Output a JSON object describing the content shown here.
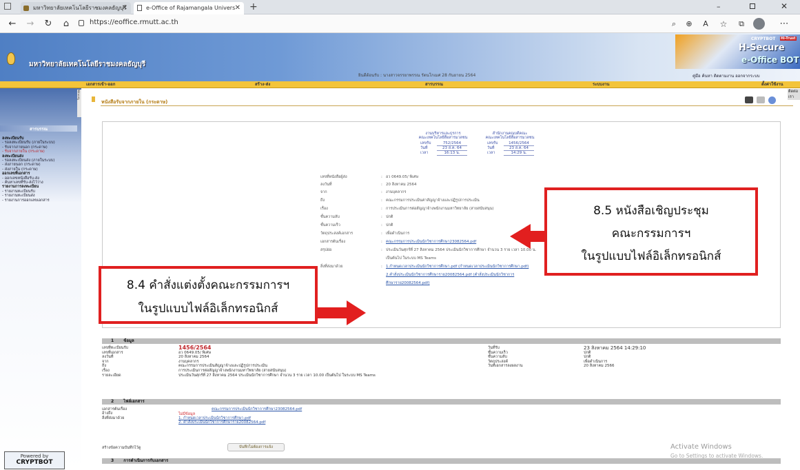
{
  "browser": {
    "tabs": [
      {
        "title": "มหาวิทยาลัยเทคโนโลยีราชมงคลธัญบุรี",
        "active": false
      },
      {
        "title": "e-Office of Rajamangala Univers",
        "active": true
      }
    ],
    "url": "https://eoffice.rmutt.ac.th",
    "new_tab": "+"
  },
  "header": {
    "university": "มหาวิทยาลัยเทคโนโลยีราชมงคลธัญบุรี",
    "welcome": "ยินดีต้อนรับ : นางสาวจรรยาพรรณ รัตนโกเมศ  28 กันยายน 2564",
    "brand_top": "CRYPTBOT",
    "brand_mid": "H-Secure",
    "brand_bottom": "e-Office BOT",
    "trust": "Hi-Trust",
    "toplinks": "คู่มือ  ค้นหา  ติดตามงาน  ออกจากระบบ"
  },
  "navbar": {
    "items": [
      "เอกสารเข้า-ออก",
      "สร้าง-ส่ง",
      "สารบรรณ",
      "ระบบงาน",
      "ตั้งค่าใช้งาน"
    ],
    "right": "ติดต่อเรา"
  },
  "sidebar": {
    "vtab": "ซ่อนเมนู",
    "title": "สารบรรณ",
    "items": [
      {
        "text": "ลงทะเบียนรับ",
        "kind": "h"
      },
      {
        "text": "- รอลงทะเบียนรับ (ภายในระบบ)",
        "kind": "n"
      },
      {
        "text": "- รับจากภายนอก (กระดาษ)",
        "kind": "n"
      },
      {
        "text": "- รับจากภายใน (กระดาษ)",
        "kind": "red"
      },
      {
        "text": "ลงทะเบียนส่ง",
        "kind": "h"
      },
      {
        "text": "- รอลงทะเบียนส่ง (ภายในระบบ)",
        "kind": "n"
      },
      {
        "text": "- ส่งภายนอก (กระดาษ)",
        "kind": "n"
      },
      {
        "text": "- ส่งภายใน (กระดาษ)",
        "kind": "n"
      },
      {
        "text": "ออกเลขที่เอกสาร",
        "kind": "h"
      },
      {
        "text": "- ออกเลขหนังสือรับ-ส่ง",
        "kind": "n"
      },
      {
        "text": "- ค้นหาเลขที่รับ-ส่งไว้ว่าง",
        "kind": "n"
      },
      {
        "text": "รายงานการลงทะเบียน",
        "kind": "h"
      },
      {
        "text": "- รายงานทะเบียนรับ",
        "kind": "n"
      },
      {
        "text": "- รายงานทะเบียนส่ง",
        "kind": "n"
      },
      {
        "text": "- รายงานการออกเลขเอกสาร",
        "kind": "n"
      }
    ],
    "powered": "Powered by",
    "powered_logo": "CRYPTBOT"
  },
  "page": {
    "title": "หนังสือรับจากภายใน (กระดาษ)"
  },
  "stamps": {
    "left": {
      "line1": "งานบริหารและธุรการ",
      "line2": "คณะเทคโนโลยีสื่อสารมวลชน",
      "rows": [
        [
          "เลขรับ",
          "752/2564"
        ],
        [
          "วันที่",
          "23 ส.ค. 64"
        ],
        [
          "เวลา",
          "16:13 น."
        ]
      ]
    },
    "right": {
      "line1": "สำนักงานคณบดีคณะ",
      "line2": "คณะเทคโนโลยีสื่อสารมวลชน",
      "rows": [
        [
          "เลขรับ",
          "1456/2564"
        ],
        [
          "วันที่",
          "23 ส.ค. 64"
        ],
        [
          "เวลา",
          "14:29 น."
        ]
      ]
    }
  },
  "doc_fields": [
    [
      "เลขที่หนังสือผู้ส่ง",
      "อว 0649.05/ พิเศษ"
    ],
    [
      "ลงวันที่",
      "20 สิงหาคม 2564"
    ],
    [
      "จาก",
      "งานบุคลากร"
    ],
    [
      "ถึง",
      "คณะกรรมการประเมินค่าสัญญาจ้างและปฏิรูปการประเมิน"
    ],
    [
      "เรื่อง",
      "การประเมินการต่อสัญญาจ้างพนักงานมหาวิทยาลัย (สายสนับสนุน)"
    ],
    [
      "ชั้นความลับ",
      "ปกติ"
    ],
    [
      "ชั้นความเร็ว",
      "ปกติ"
    ],
    [
      "วัตถุประสงค์เอกสาร",
      "เพื่อดำเนินการ"
    ],
    [
      "เอกสารต้นเรื่อง",
      "คณะกรรมการประเมินนักวิชาการศึกษา23082564.pdf"
    ],
    [
      "สรุปย่อ",
      "ประเมินวันศุกร์ที่ 27 สิงหาคม 2564 ประเมินนักวิชาการศึกษา จำนวน 3 ราย เวลา 10.00 น."
    ],
    [
      "",
      "เป็นต้นไป ในระบบ MS Teams"
    ],
    [
      "สิ่งที่ส่งมาด้วย",
      "1.กำหนดเวลาประเมินนักวิชาการศึกษา.pdf (กำหนดเวลาประเมินนักวิชาการศึกษา.pdf)"
    ],
    [
      "",
      "2.คำสั่งประเมินนักวิชาการศึกษาราย20082564.pdf (คำสั่งประเมินนักวิชาการ"
    ],
    [
      "",
      "ศึกษาราย20082564.pdf)"
    ]
  ],
  "callouts": {
    "left_line1": "8.4 คำสั่งแต่งตั้งคณะกรรมการฯ",
    "left_line2": "ในรูปแบบไฟล์อิเล็กทรอนิกส์",
    "right_line1": "8.5 หนังสือเชิญประชุม",
    "right_line2": "คณะกรรมการฯ",
    "right_line3": "ในรูปแบบไฟล์อิเล็กทรอนิกส์"
  },
  "section1": {
    "num": "1",
    "title": "ข้อมูล",
    "left_labels": [
      "เลขที่ทะเบียนรับ",
      "เลขที่เอกสาร",
      "ลงวันที่",
      "จาก",
      "ถึง",
      "เรื่อง",
      "รายละเอียด"
    ],
    "left_values": [
      "1456/2564",
      "อว 0649.05/ พิเศษ",
      "20 สิงหาคม 2564",
      "งานบุคลากร",
      "คณะกรรมการประเมินสัญญาจ้างและปฏิรูปการประเมิน",
      "การประเมินการต่อสัญญาจ้างพนักงานมหาวิทยาลัย (สายสนับสนุน)",
      "ประเมินวันศุกร์ที่ 27 สิงหาคม 2564 ประเมินนักวิชาการศึกษา จำนวน 3 ราย เวลา 10.00 เป็นต้นไป ในระบบ MS Teams"
    ],
    "right_labels": [
      "วันที่รับ",
      "ชั้นความเร็ว",
      "ชั้นความลับ",
      "วัตถุประสงค์",
      "วันที่เอกสารลงผลงาน"
    ],
    "right_values": [
      "23 สิงหาคม 2564  14:29:10",
      "ปกติ",
      "ปกติ",
      "เพื่อดำเนินการ",
      "20 สิงหาคม 2566"
    ]
  },
  "section2": {
    "num": "2",
    "title": "ไฟล์เอกสาร",
    "labels": [
      "เอกสารต้นเรื่อง",
      "อ้างถึง",
      "สิ่งที่ส่งมาด้วย"
    ],
    "doc": "คณะกรรมการประเมินนักวิชาการศึกษา23082564.pdf",
    "ref": "ไม่มีข้อมูล",
    "att1": "1. กำหนดเวลาประเมินนักวิชาการศึกษา.pdf",
    "att2": "2. คำสั่งประเมินนักวิชาการศึกษาราย20082564.pdf"
  },
  "note": {
    "label": "สร้างข้อความบันทึกไว้ดู",
    "button": "บันทึกไม่ต้องการแจ้ง"
  },
  "section3": {
    "num": "3",
    "title": "การดำเนินการกับเอกสาร"
  },
  "activate": {
    "line1": "Activate Windows",
    "line2": "Go to Settings to activate Windows."
  },
  "colors": {
    "callout_border": "#e02020",
    "navbar": "#f3c43a",
    "header_blue": "#4f7fc4"
  }
}
